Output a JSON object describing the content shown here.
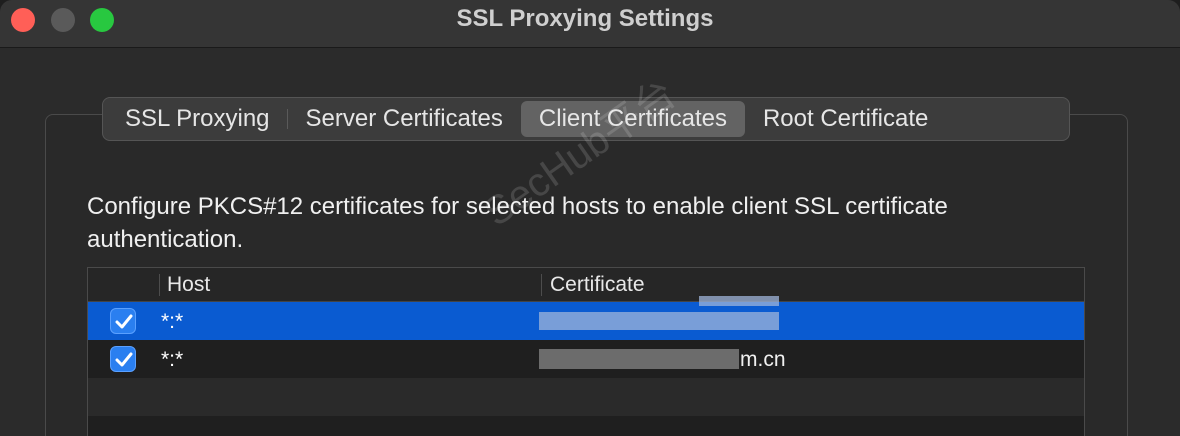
{
  "window": {
    "title": "SSL Proxying Settings"
  },
  "tabs": [
    {
      "label": "SSL Proxying",
      "active": false
    },
    {
      "label": "Server Certificates",
      "active": false
    },
    {
      "label": "Client Certificates",
      "active": true
    },
    {
      "label": "Root Certificate",
      "active": false
    }
  ],
  "description": "Configure PKCS#12 certificates for selected hosts to enable client SSL certificate authentication.",
  "table": {
    "columns": [
      "Host",
      "Certificate"
    ],
    "rows": [
      {
        "checked": true,
        "host": "*:*",
        "certificate": "",
        "selected": true
      },
      {
        "checked": true,
        "host": "*:*",
        "certificate": "m.cn",
        "selected": false
      }
    ]
  },
  "watermark": "SecHub平台",
  "colors": {
    "selection": "#0a5bd1",
    "checkbox": "#2a7ff0",
    "close": "#ff5f57",
    "maximize": "#28c840"
  }
}
